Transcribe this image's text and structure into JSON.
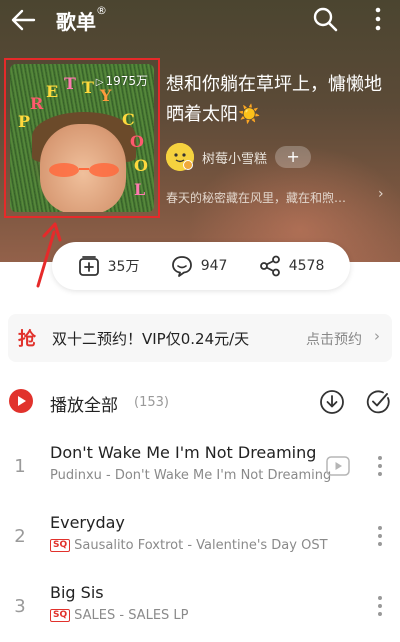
{
  "header": {
    "title": "歌单",
    "title_mark": "®"
  },
  "cover": {
    "play_count": "1975万",
    "letters": [
      "P",
      "R",
      "E",
      "T",
      "T",
      "Y",
      "C",
      "O",
      "O",
      "L"
    ]
  },
  "playlist": {
    "title": "想和你躺在草坪上，慵懒地晒着太阳☀️",
    "creator_name": "树莓小雪糕",
    "follow_label": "+",
    "description": "春天的秘密藏在风里，藏在和煦…",
    "desc_chevron": "›"
  },
  "stats": {
    "collect": "35万",
    "comments": "947",
    "shares": "4578"
  },
  "vip": {
    "badge": "抢",
    "text": "双十二预约！VIP仅0.24元/天",
    "cta": "点击预约",
    "chevron": "›"
  },
  "playall": {
    "label": "播放全部",
    "count": "(153)"
  },
  "songs": [
    {
      "index": "1",
      "title": "Don't Wake Me I'm Not Dreaming",
      "subtitle": "Pudinxu - Don't Wake Me I'm Not Dreaming",
      "sq": false,
      "mv": true
    },
    {
      "index": "2",
      "title": "Everyday",
      "subtitle": "Sausalito Foxtrot - Valentine's Day OST",
      "sq": true,
      "mv": false
    },
    {
      "index": "3",
      "title": "Big Sis",
      "subtitle": "SALES - SALES LP",
      "sq": true,
      "mv": false
    }
  ],
  "badges": {
    "sq": "SQ"
  },
  "icons": {
    "back": "arrow-left-icon",
    "search": "search-icon",
    "more": "more-vertical-icon",
    "collect": "add-to-collection-icon",
    "comment": "comment-icon",
    "share": "share-icon",
    "playall": "play-circle-icon",
    "download": "download-icon",
    "multiselect": "check-list-icon",
    "mv": "video-play-icon"
  },
  "colors": {
    "accent": "#e1322c",
    "annotation": "#e62a2a"
  }
}
